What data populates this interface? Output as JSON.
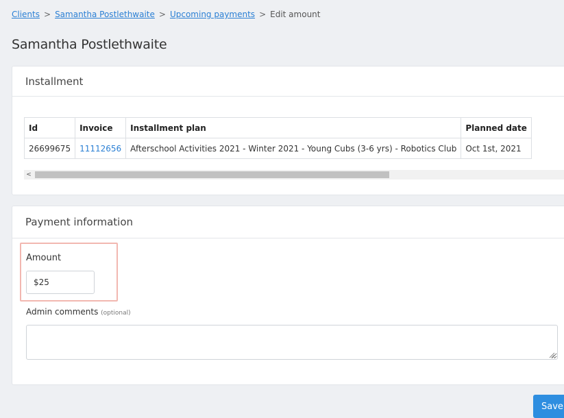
{
  "breadcrumb": {
    "items": [
      {
        "label": "Clients",
        "link": true
      },
      {
        "label": "Samantha Postlethwaite",
        "link": true
      },
      {
        "label": "Upcoming payments",
        "link": true
      },
      {
        "label": "Edit amount",
        "link": false
      }
    ],
    "separator": ">"
  },
  "page": {
    "title": "Samantha Postlethwaite"
  },
  "installment": {
    "title": "Installment",
    "columns": [
      "Id",
      "Invoice",
      "Installment plan",
      "Planned date"
    ],
    "rows": [
      [
        "26699675",
        "11112656",
        "Afterschool Activities 2021 - Winter 2021 - Young Cubs (3-6 yrs) - Robotics Club",
        "Oct 1st, 2021"
      ]
    ],
    "scrollbar": {
      "left_arrow": "<",
      "right_arrow": ">"
    }
  },
  "payment": {
    "title": "Payment information",
    "amount_label": "Amount",
    "amount_value": "$25",
    "comments_label": "Admin comments",
    "comments_optional": "(optional)",
    "comments_value": ""
  },
  "actions": {
    "save_label": "Save"
  },
  "colors": {
    "accent": "#2e8ee0",
    "link": "#2a7fd4",
    "highlight": "#f2b7b0",
    "background": "#eef0f3"
  }
}
